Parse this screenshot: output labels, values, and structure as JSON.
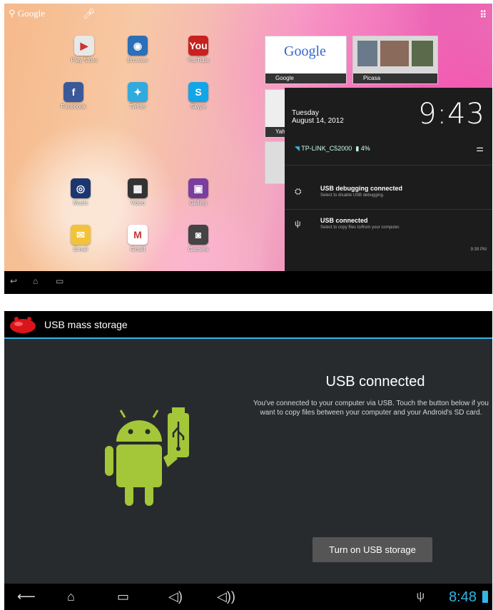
{
  "top": {
    "search_label": "Google",
    "apps": [
      {
        "label": "Play Store",
        "icon": "play-store-icon",
        "color": "#e8e8e8",
        "glyph": "▶"
      },
      {
        "label": "Browser",
        "icon": "globe-icon",
        "color": "#2b6fb8",
        "glyph": "◉"
      },
      {
        "label": "YouTube",
        "icon": "youtube-icon",
        "color": "#c8201e",
        "glyph": "You"
      },
      {
        "label": "Facebook",
        "icon": "facebook-icon",
        "color": "#3b5998",
        "glyph": "f"
      },
      {
        "label": "Twitter",
        "icon": "twitter-icon",
        "color": "#33aadd",
        "glyph": "✦"
      },
      {
        "label": "Skype",
        "icon": "skype-icon",
        "color": "#12a5e8",
        "glyph": "S"
      },
      {
        "label": "Music",
        "icon": "music-icon",
        "color": "#1c3770",
        "glyph": "◎"
      },
      {
        "label": "Video",
        "icon": "video-icon",
        "color": "#333333",
        "glyph": "▦"
      },
      {
        "label": "Gallery",
        "icon": "gallery-icon",
        "color": "#7a3e9e",
        "glyph": "▣"
      },
      {
        "label": "Email",
        "icon": "email-icon",
        "color": "#f2c33a",
        "glyph": "✉"
      },
      {
        "label": "Gmail",
        "icon": "gmail-icon",
        "color": "#ffffff",
        "glyph": "M"
      },
      {
        "label": "Camera",
        "icon": "camera-icon",
        "color": "#444444",
        "glyph": "◙"
      }
    ],
    "recents": [
      {
        "label": "Google"
      },
      {
        "label": "Picasa"
      },
      {
        "label": "Yahoo"
      }
    ],
    "recent_google_logo": "Google",
    "notification": {
      "day": "Tuesday",
      "date": "August 14, 2012",
      "clock": "9:43",
      "wifi": "TP-LINK_C52000",
      "battery": "4%",
      "items": [
        {
          "title": "USB debugging connected",
          "subtitle": "Select to disable USB debugging."
        },
        {
          "title": "USB connected",
          "subtitle": "Select to copy files to/from your computer."
        }
      ],
      "time": "9:39 PM"
    }
  },
  "bottom": {
    "action_bar_title": "USB mass storage",
    "heading": "USB connected",
    "body": "You've connected to your computer via USB. Touch the button below if you want to copy files between your computer and your Android's SD card.",
    "button_label": "Turn on USB storage",
    "status_time": "8:48",
    "colors": {
      "accent": "#33b5e5",
      "android_green": "#a4c639"
    }
  }
}
